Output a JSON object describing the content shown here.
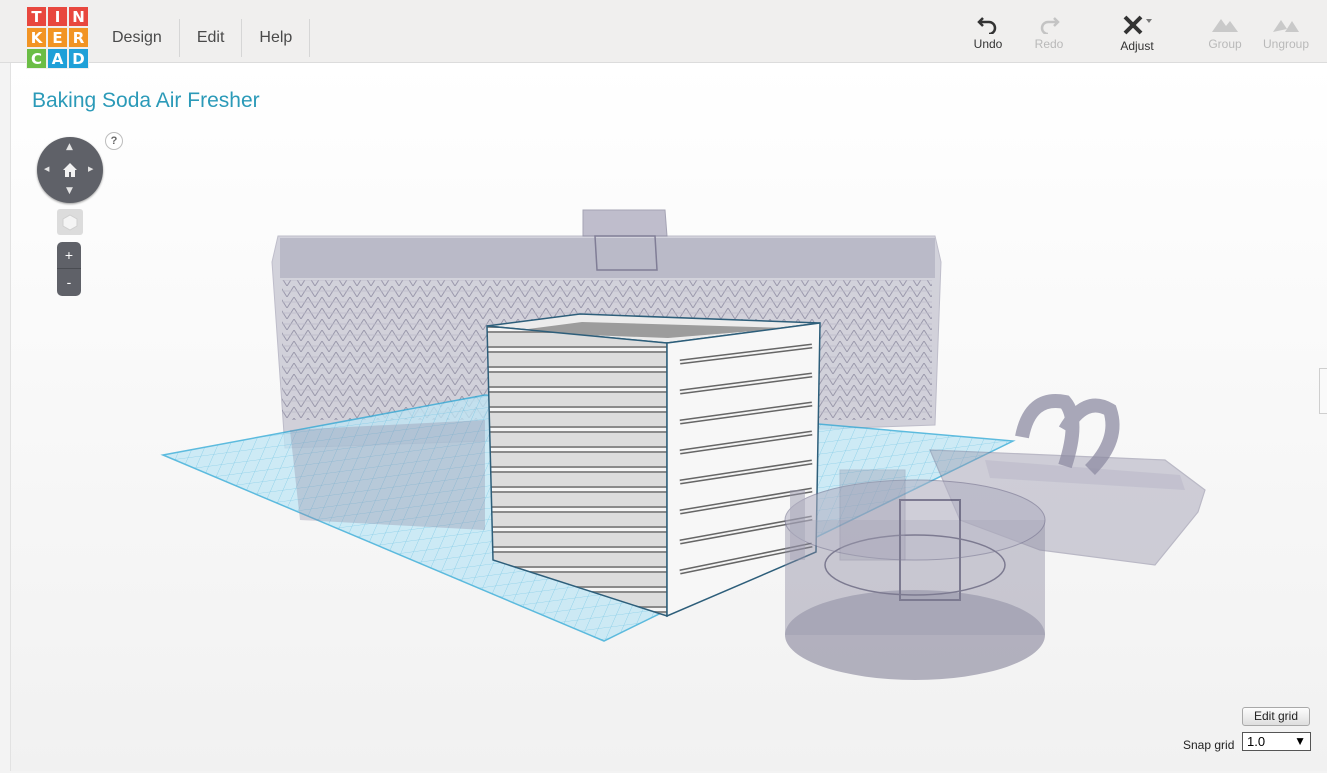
{
  "app": {
    "logo_letters": [
      "T",
      "I",
      "N",
      "K",
      "E",
      "R",
      "C",
      "A",
      "D"
    ],
    "logo_colors": [
      "#e8473e",
      "#e8473e",
      "#e8473e",
      "#f29424",
      "#f29424",
      "#f29424",
      "#6bbd45",
      "#1fa0d8",
      "#1fa0d8"
    ]
  },
  "menu": {
    "design": "Design",
    "edit": "Edit",
    "help": "Help"
  },
  "toolbar": {
    "undo": "Undo",
    "redo": "Redo",
    "adjust": "Adjust",
    "group": "Group",
    "ungroup": "Ungroup"
  },
  "project": {
    "title": "Baking Soda Air Fresher"
  },
  "nav": {
    "help_label": "?",
    "zoom_in": "+",
    "zoom_out": "-"
  },
  "grid": {
    "edit_grid": "Edit grid",
    "snap_grid_label": "Snap grid",
    "snap_value": "1.0"
  },
  "colors": {
    "accent": "#2b9ab8",
    "workplane": "#3ab3e0",
    "ghost_shape": "#8e8ca3",
    "solid_shape": "#d8d8d8"
  }
}
